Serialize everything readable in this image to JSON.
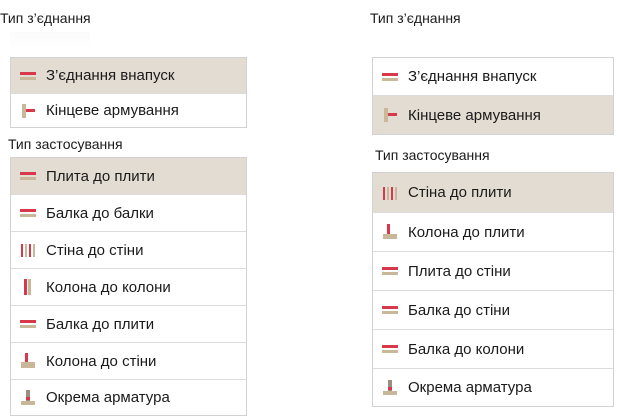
{
  "left": {
    "connection_type_title": "Тип з’єднання",
    "connection_items": [
      {
        "label": "З’єднання внапуск",
        "icon": "lap-joint-icon",
        "selected": true
      },
      {
        "label": "Кінцеве армування",
        "icon": "end-reinforcement-icon",
        "selected": false
      }
    ],
    "application_type_title": "Тип застосування",
    "application_items": [
      {
        "label": "Плита до плити",
        "icon": "slab-to-slab-icon",
        "selected": true
      },
      {
        "label": "Балка до балки",
        "icon": "beam-to-beam-icon",
        "selected": false
      },
      {
        "label": "Стіна до стіни",
        "icon": "wall-to-wall-icon",
        "selected": false
      },
      {
        "label": "Колона до колони",
        "icon": "column-to-column-icon",
        "selected": false
      },
      {
        "label": "Балка до плити",
        "icon": "beam-to-slab-icon",
        "selected": false
      },
      {
        "label": "Колона до стіни",
        "icon": "column-to-wall-icon",
        "selected": false
      },
      {
        "label": "Окрема арматура",
        "icon": "individual-rebar-icon",
        "selected": false
      }
    ]
  },
  "right": {
    "connection_type_title": "Тип з’єднання",
    "connection_items": [
      {
        "label": "З’єднання внапуск",
        "icon": "lap-joint-icon",
        "selected": false
      },
      {
        "label": "Кінцеве армування",
        "icon": "end-reinforcement-icon",
        "selected": true
      }
    ],
    "application_type_title": "Тип застосування",
    "application_items": [
      {
        "label": "Стіна до плити",
        "icon": "wall-to-slab-icon",
        "selected": true
      },
      {
        "label": "Колона до плити",
        "icon": "column-to-slab-icon",
        "selected": false
      },
      {
        "label": "Плита до стіни",
        "icon": "slab-to-wall-icon",
        "selected": false
      },
      {
        "label": "Балка до стіни",
        "icon": "beam-to-wall-icon",
        "selected": false
      },
      {
        "label": "Балка до колони",
        "icon": "beam-to-column-icon",
        "selected": false
      },
      {
        "label": "Окрема арматура",
        "icon": "individual-rebar-icon",
        "selected": false
      }
    ]
  },
  "colors": {
    "selected_bg": "#e2dcd2",
    "border": "#d2d2d2",
    "icon_red": "#d8384a",
    "icon_tan": "#c9b79a",
    "icon_grey": "#9a8e80"
  }
}
